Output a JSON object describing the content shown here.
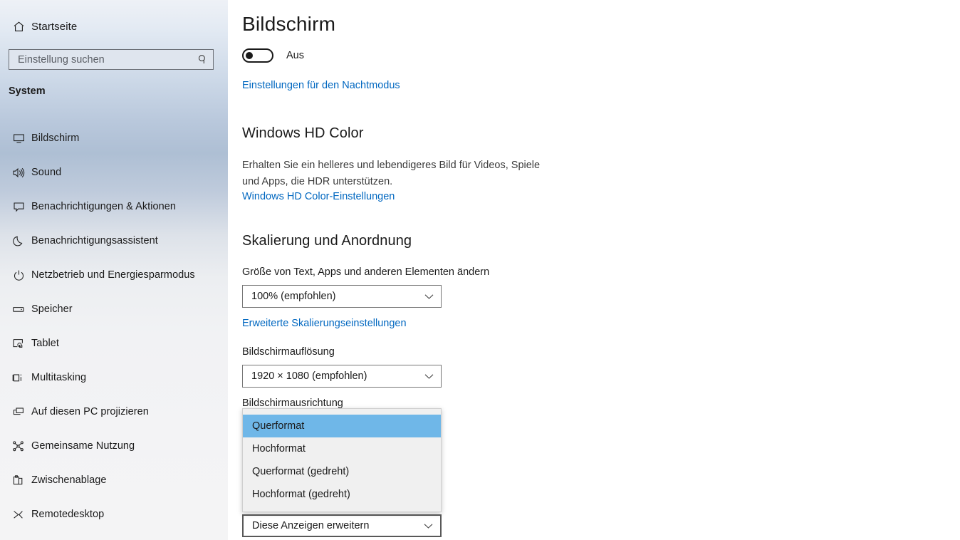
{
  "sidebar": {
    "home": {
      "label": "Startseite",
      "icon": "home-icon"
    },
    "search": {
      "placeholder": "Einstellung suchen",
      "value": "",
      "icon": "search-icon"
    },
    "section_header": "System",
    "items": [
      {
        "label": "Bildschirm",
        "icon": "monitor-icon",
        "selected": true
      },
      {
        "label": "Sound",
        "icon": "speaker-icon",
        "selected": false
      },
      {
        "label": "Benachrichtigungen & Aktionen",
        "icon": "chat-bubble-icon",
        "selected": false
      },
      {
        "label": "Benachrichtigungsassistent",
        "icon": "moon-icon",
        "selected": false
      },
      {
        "label": "Netzbetrieb und Energiesparmodus",
        "icon": "power-icon",
        "selected": false
      },
      {
        "label": "Speicher",
        "icon": "drive-icon",
        "selected": false
      },
      {
        "label": "Tablet",
        "icon": "tablet-touch-icon",
        "selected": false
      },
      {
        "label": "Multitasking",
        "icon": "multitasking-icon",
        "selected": false
      },
      {
        "label": "Auf diesen PC projizieren",
        "icon": "project-screen-icon",
        "selected": false
      },
      {
        "label": "Gemeinsame Nutzung",
        "icon": "share-icon",
        "selected": false
      },
      {
        "label": "Zwischenablage",
        "icon": "clipboard-icon",
        "selected": false
      },
      {
        "label": "Remotedesktop",
        "icon": "remote-desktop-icon",
        "selected": false
      }
    ]
  },
  "main": {
    "title": "Bildschirm",
    "night_mode": {
      "toggle_state": "Aus",
      "toggle_on": false,
      "link": "Einstellungen für den Nachtmodus"
    },
    "hd_color": {
      "heading": "Windows HD Color",
      "description": "Erhalten Sie ein helleres und lebendigeres Bild für Videos, Spiele und Apps, die HDR unterstützen.",
      "link": "Windows HD Color-Einstellungen"
    },
    "scaling": {
      "heading": "Skalierung und Anordnung",
      "size_label": "Größe von Text, Apps und anderen Elementen ändern",
      "size_value": "100% (empfohlen)",
      "advanced_link": "Erweiterte Skalierungseinstellungen",
      "resolution_label": "Bildschirmauflösung",
      "resolution_value": "1920 × 1080 (empfohlen)",
      "orientation_label": "Bildschirmausrichtung",
      "orientation_value": "Querformat",
      "multiple_displays_value": "Diese Anzeigen erweitern"
    },
    "orientation_dropdown": {
      "open": true,
      "options": [
        "Querformat",
        "Hochformat",
        "Querformat (gedreht)",
        "Hochformat (gedreht)"
      ],
      "highlighted_index": 0
    }
  },
  "colors": {
    "link": "#0067c0",
    "highlight": "#6fb7e8",
    "dropdown_bg": "#f0f0f0",
    "sidebar_accent": "#aebfd4",
    "text": "#1a1a1a"
  }
}
